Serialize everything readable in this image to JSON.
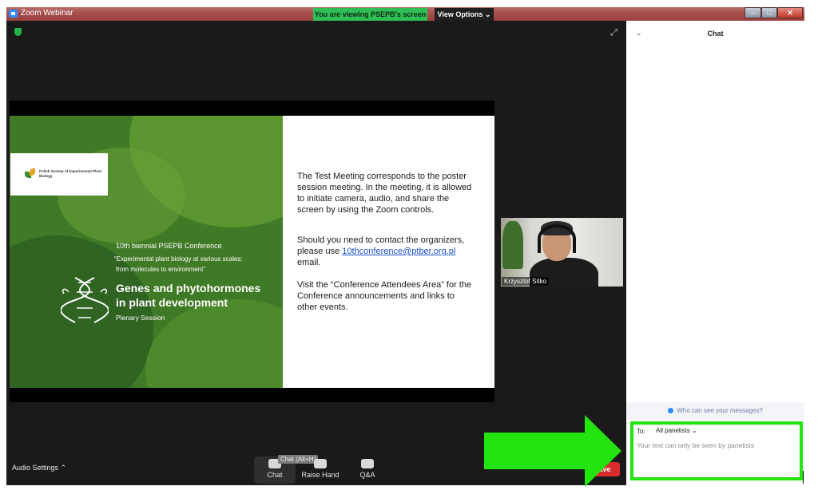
{
  "window": {
    "title": "Zoom Webinar",
    "viewing_banner": "You are viewing PSEPB's screen",
    "view_options": "View Options ⌄",
    "controls": {
      "minimize": "–",
      "maximize": "□",
      "close": "✕"
    }
  },
  "slide": {
    "logo_text": "Polish Society of Experimental Plant Biology",
    "conference_title": "10th biennial PSEPB Conference",
    "conference_subtitle_1": "“Experimental plant biology at various scales:",
    "conference_subtitle_2": "from molecules to environment”",
    "session_title_1": "Genes and phytohormones",
    "session_title_2": "in plant development",
    "session_type": "Plenary Session",
    "paragraph_1": "The Test Meeting corresponds to the poster session meeting. In the meeting, it is allowed to initiate camera, audio, and share the screen by using the Zoom controls.",
    "paragraph_2_before": "Should you need to contact the organizers, please use ",
    "paragraph_2_link": "10thconference@ptber.org.pl",
    "paragraph_2_after": " email.",
    "paragraph_3": "Visit the “Conference Attendees Area” for the Conference announcements and links to other events."
  },
  "participant": {
    "name": "Krzysztof Sitko"
  },
  "toolbar": {
    "audio_settings": "Audio Settings ⌃",
    "chat_label": "Chat",
    "chat_tooltip": "Chat (Alt+H)",
    "raise_hand_label": "Raise Hand",
    "qa_label": "Q&A",
    "leave_label": "ave"
  },
  "chat": {
    "title": "Chat",
    "collapse_icon": "⌄",
    "who_can_see": "Who can see your messages?",
    "to_label": "To:",
    "to_value": "All panelists ⌄",
    "placeholder": "Your text can only be seen by panelists"
  },
  "colors": {
    "highlight_green": "#23e40e",
    "banner_green": "#2fbd55",
    "leave_red": "#d92c2c"
  }
}
